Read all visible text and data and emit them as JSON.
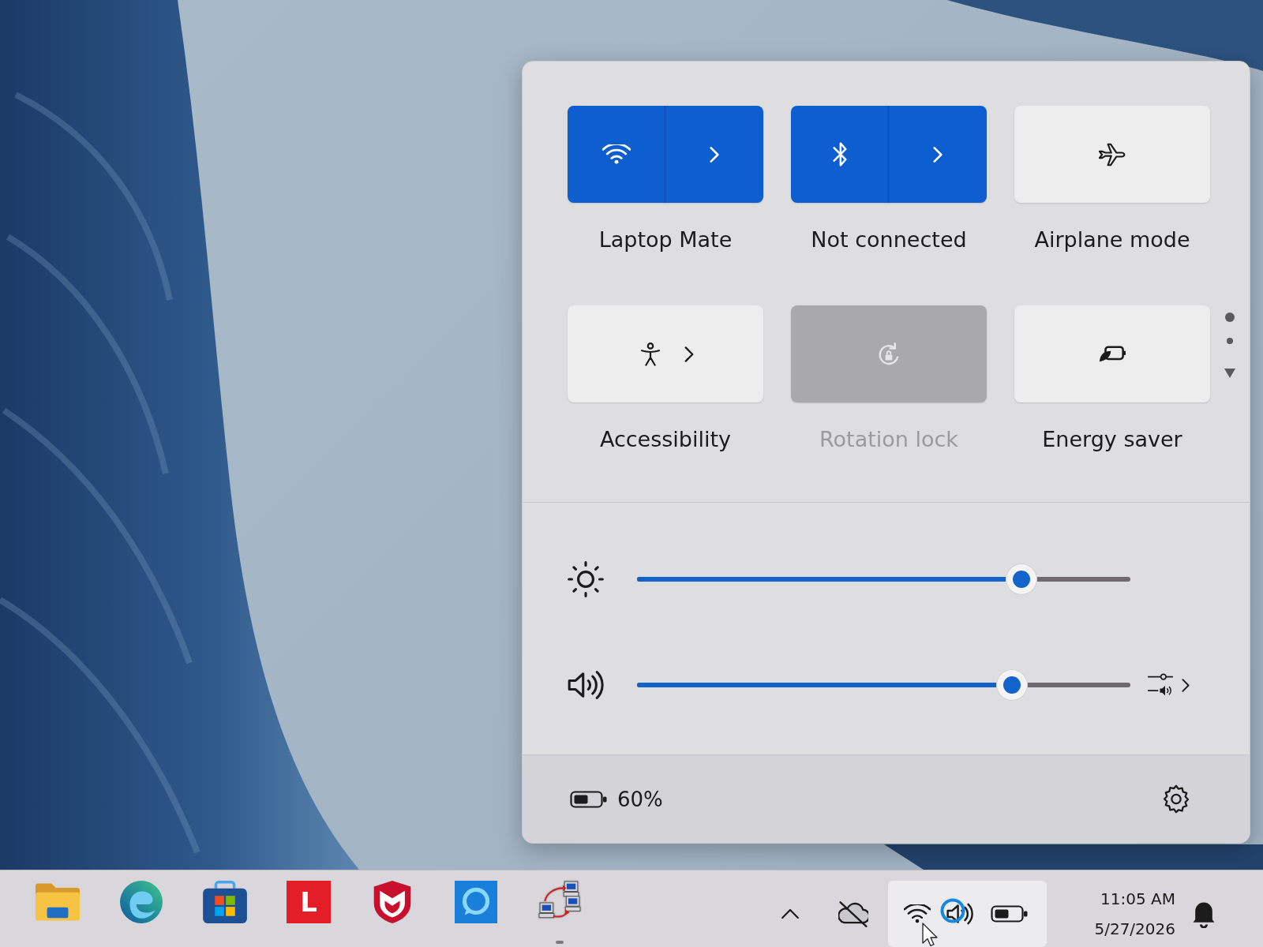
{
  "quick_settings": {
    "tiles": [
      {
        "kind": "split",
        "label": "Laptop Mate",
        "on": true,
        "disabled": false
      },
      {
        "kind": "split",
        "label": "Not connected",
        "on": true,
        "disabled": false
      },
      {
        "kind": "toggle",
        "label": "Airplane mode",
        "on": false,
        "disabled": false
      },
      {
        "kind": "expand",
        "label": "Accessibility",
        "on": false,
        "disabled": false
      },
      {
        "kind": "toggle",
        "label": "Rotation lock",
        "on": false,
        "disabled": true
      },
      {
        "kind": "toggle",
        "label": "Energy saver",
        "on": false,
        "disabled": false
      }
    ],
    "pages": [
      {
        "selected": true
      },
      {
        "selected": false
      }
    ],
    "sliders": [
      {
        "kind": "brightness",
        "level": 0.78
      },
      {
        "kind": "volume",
        "level": 0.76
      }
    ],
    "battery": {
      "reading": "60%"
    }
  },
  "taskbar": {
    "apps": [
      {
        "running": false
      },
      {
        "running": false
      },
      {
        "running": false
      },
      {
        "running": false,
        "glyph": "L"
      },
      {
        "running": false
      },
      {
        "running": false
      },
      {
        "running": true
      }
    ],
    "tray": {
      "status_hover": true,
      "clock": {
        "time": "11:05 AM",
        "date": "5/27/2026"
      }
    }
  }
}
